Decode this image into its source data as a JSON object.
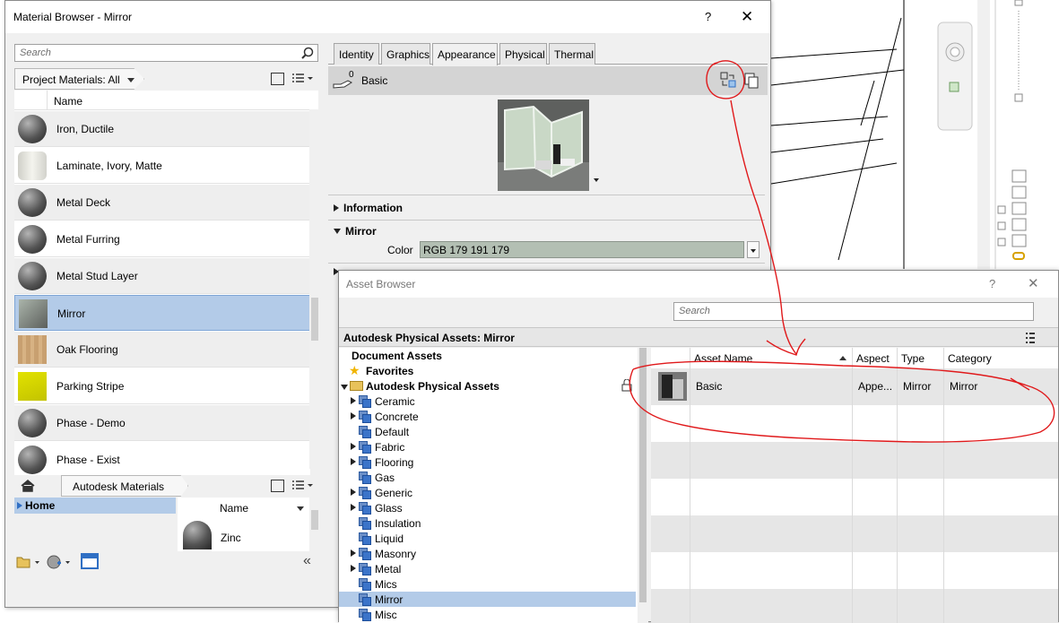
{
  "material_browser": {
    "title": "Material Browser - Mirror",
    "help": "?",
    "close": "✕",
    "search_placeholder": "Search",
    "project_filter": "Project Materials: All",
    "name_header": "Name",
    "materials": [
      {
        "name": "Iron, Ductile"
      },
      {
        "name": "Laminate, Ivory, Matte"
      },
      {
        "name": "Metal Deck"
      },
      {
        "name": "Metal Furring"
      },
      {
        "name": "Metal Stud Layer"
      },
      {
        "name": "Mirror"
      },
      {
        "name": "Oak Flooring"
      },
      {
        "name": "Parking Stripe"
      },
      {
        "name": "Phase - Demo"
      },
      {
        "name": "Phase - Exist"
      }
    ],
    "library_breadcrumb": "Autodesk Materials",
    "library_tree_home": "Home",
    "library_name_header": "Name",
    "library_items": [
      {
        "name": "Zinc"
      }
    ],
    "tabs": [
      "Identity",
      "Graphics",
      "Appearance",
      "Physical",
      "Thermal"
    ],
    "active_tab": "Appearance",
    "asset_count": "0",
    "asset_name": "Basic",
    "sections": {
      "information": "Information",
      "mirror": "Mirror",
      "color_label": "Color",
      "color_value": "RGB 179 191 179",
      "color_swatch": "#b3bfb3"
    }
  },
  "asset_browser": {
    "title": "Asset Browser",
    "help": "?",
    "search_placeholder": "Search",
    "header": "Autodesk Physical Assets: Mirror",
    "tree": {
      "document_assets": "Document Assets",
      "favorites": "Favorites",
      "library": "Autodesk Physical Assets",
      "categories": [
        {
          "label": "Ceramic",
          "expandable": true
        },
        {
          "label": "Concrete",
          "expandable": true
        },
        {
          "label": "Default",
          "expandable": false
        },
        {
          "label": "Fabric",
          "expandable": true
        },
        {
          "label": "Flooring",
          "expandable": true
        },
        {
          "label": "Gas",
          "expandable": false
        },
        {
          "label": "Generic",
          "expandable": true
        },
        {
          "label": "Glass",
          "expandable": true
        },
        {
          "label": "Insulation",
          "expandable": false
        },
        {
          "label": "Liquid",
          "expandable": false
        },
        {
          "label": "Masonry",
          "expandable": true
        },
        {
          "label": "Metal",
          "expandable": true
        },
        {
          "label": "Mics",
          "expandable": false
        },
        {
          "label": "Mirror",
          "expandable": false,
          "selected": true
        },
        {
          "label": "Misc",
          "expandable": false
        }
      ]
    },
    "columns": {
      "asset_name": "Asset Name",
      "aspect": "Aspect",
      "type": "Type",
      "category": "Category"
    },
    "rows": [
      {
        "asset_name": "Basic",
        "aspect": "Appe...",
        "type": "Mirror",
        "category": "Mirror"
      }
    ]
  },
  "colors": {
    "selection": "#b3cbe8",
    "annotation": "#e0191b",
    "accent": "#2f6fc4"
  }
}
